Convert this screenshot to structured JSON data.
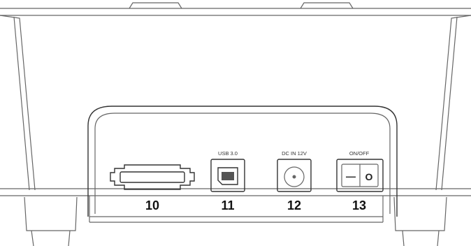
{
  "ports": [
    {
      "number": "10",
      "label": "",
      "icon": "esata-port-icon"
    },
    {
      "number": "11",
      "label": "USB 3.0",
      "icon": "usb-b-port-icon"
    },
    {
      "number": "12",
      "label": "DC IN 12V",
      "icon": "dc-jack-icon"
    },
    {
      "number": "13",
      "label": "ON/OFF",
      "icon": "power-switch-icon"
    }
  ],
  "switch": {
    "off_symbol": "—",
    "on_symbol": "O"
  }
}
